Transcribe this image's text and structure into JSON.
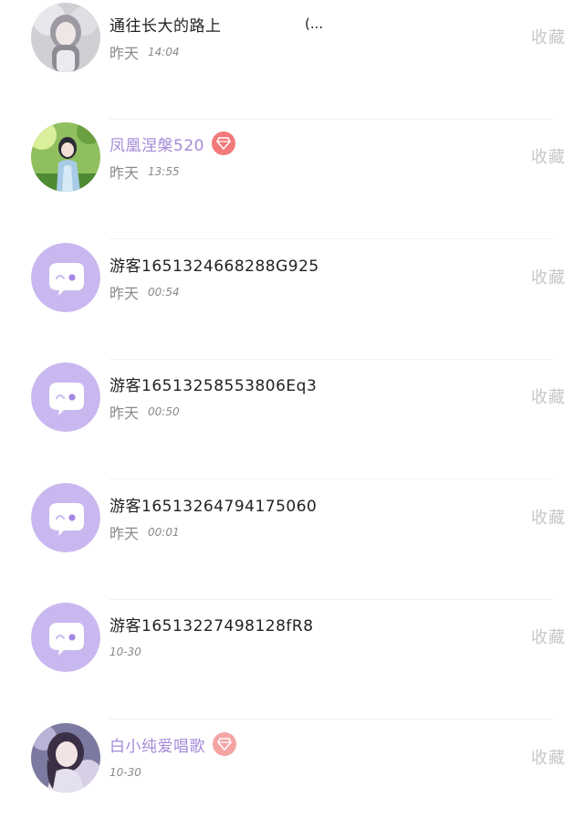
{
  "collect_label": "收藏",
  "colors": {
    "vip_name": "#a58ad8",
    "name": "#222222",
    "meta": "#8a8a8a",
    "collect": "#c7c7c7",
    "guest_avatar_bg": "#c9b8ef",
    "vip_badge": "#f27a7a"
  },
  "items": [
    {
      "name": "通往长大的路上",
      "ellipsis": "(...",
      "day": "昨天",
      "time": "14:04",
      "vip": false,
      "avatar": "photo-girl-white"
    },
    {
      "name": "凤凰涅槃520",
      "day": "昨天",
      "time": "13:55",
      "vip": true,
      "avatar": "photo-girl-garden"
    },
    {
      "name": "游客1651324668288G925",
      "day": "昨天",
      "time": "00:54",
      "vip": false,
      "avatar": "guest-chat-icon"
    },
    {
      "name": "游客16513258553806Eq3",
      "day": "昨天",
      "time": "00:50",
      "vip": false,
      "avatar": "guest-chat-icon"
    },
    {
      "name": "游客16513264794175060",
      "day": "昨天",
      "time": "00:01",
      "vip": false,
      "avatar": "guest-chat-icon"
    },
    {
      "name": "游客16513227498128fR8",
      "day": "",
      "time": "10-30",
      "vip": false,
      "avatar": "guest-chat-icon"
    },
    {
      "name": "白小纯爱唱歌",
      "day": "",
      "time": "10-30",
      "vip": true,
      "avatar": "photo-girl-anime"
    }
  ]
}
